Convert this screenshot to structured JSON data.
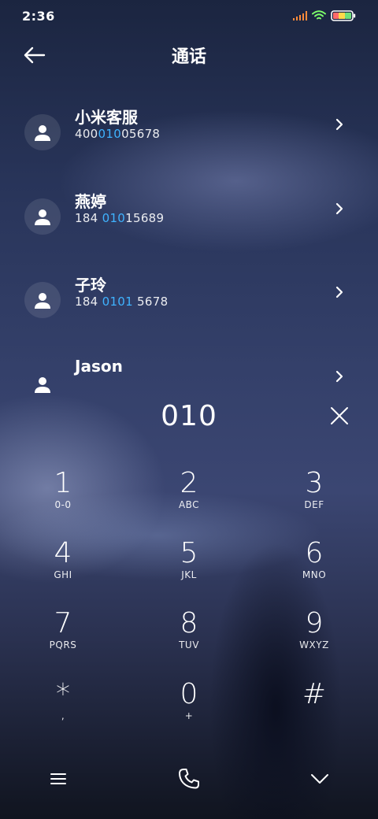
{
  "status": {
    "time": "2:36",
    "signal_color": "#ff8a3a"
  },
  "header": {
    "title": "通话",
    "back_icon": "arrow-left-icon"
  },
  "contacts": [
    {
      "name": "小米客服",
      "number_pre": "400",
      "number_hl": "010",
      "number_post": "05678"
    },
    {
      "name": "燕婷",
      "number_pre": "184 ",
      "number_hl": "010",
      "number_post": "15689"
    },
    {
      "name": "子玲",
      "number_pre": "184 ",
      "number_hl": "0101",
      "number_post": " 5678"
    },
    {
      "name": "Jason",
      "number_pre": "",
      "number_hl": "",
      "number_post": ""
    }
  ],
  "dial": {
    "number": "010",
    "highlight_color": "#3fb3ff"
  },
  "keypad": [
    {
      "digit": "1",
      "letters": "0-0"
    },
    {
      "digit": "2",
      "letters": "ABC"
    },
    {
      "digit": "3",
      "letters": "DEF"
    },
    {
      "digit": "4",
      "letters": "GHI"
    },
    {
      "digit": "5",
      "letters": "JKL"
    },
    {
      "digit": "6",
      "letters": "MNO"
    },
    {
      "digit": "7",
      "letters": "PQRS"
    },
    {
      "digit": "8",
      "letters": "TUV"
    },
    {
      "digit": "9",
      "letters": "WXYZ"
    },
    {
      "digit": "*",
      "letters": ","
    },
    {
      "digit": "0",
      "letters": "+"
    },
    {
      "digit": "#",
      "letters": ""
    }
  ],
  "bottom": {
    "menu_icon": "menu-icon",
    "call_icon": "phone-icon",
    "collapse_icon": "chevron-down-icon"
  }
}
